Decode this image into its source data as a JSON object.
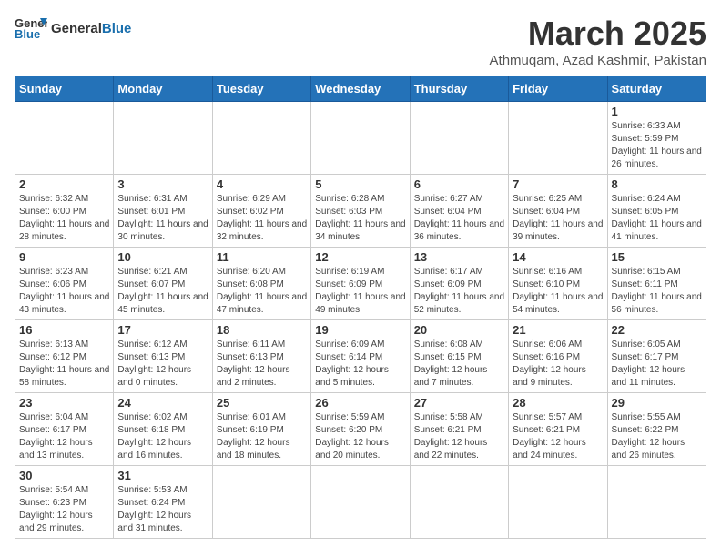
{
  "header": {
    "logo_general": "General",
    "logo_blue": "Blue",
    "month": "March 2025",
    "location": "Athmuqam, Azad Kashmir, Pakistan"
  },
  "weekdays": [
    "Sunday",
    "Monday",
    "Tuesday",
    "Wednesday",
    "Thursday",
    "Friday",
    "Saturday"
  ],
  "weeks": [
    [
      {
        "day": "",
        "info": ""
      },
      {
        "day": "",
        "info": ""
      },
      {
        "day": "",
        "info": ""
      },
      {
        "day": "",
        "info": ""
      },
      {
        "day": "",
        "info": ""
      },
      {
        "day": "",
        "info": ""
      },
      {
        "day": "1",
        "info": "Sunrise: 6:33 AM\nSunset: 5:59 PM\nDaylight: 11 hours and 26 minutes."
      }
    ],
    [
      {
        "day": "2",
        "info": "Sunrise: 6:32 AM\nSunset: 6:00 PM\nDaylight: 11 hours and 28 minutes."
      },
      {
        "day": "3",
        "info": "Sunrise: 6:31 AM\nSunset: 6:01 PM\nDaylight: 11 hours and 30 minutes."
      },
      {
        "day": "4",
        "info": "Sunrise: 6:29 AM\nSunset: 6:02 PM\nDaylight: 11 hours and 32 minutes."
      },
      {
        "day": "5",
        "info": "Sunrise: 6:28 AM\nSunset: 6:03 PM\nDaylight: 11 hours and 34 minutes."
      },
      {
        "day": "6",
        "info": "Sunrise: 6:27 AM\nSunset: 6:04 PM\nDaylight: 11 hours and 36 minutes."
      },
      {
        "day": "7",
        "info": "Sunrise: 6:25 AM\nSunset: 6:04 PM\nDaylight: 11 hours and 39 minutes."
      },
      {
        "day": "8",
        "info": "Sunrise: 6:24 AM\nSunset: 6:05 PM\nDaylight: 11 hours and 41 minutes."
      }
    ],
    [
      {
        "day": "9",
        "info": "Sunrise: 6:23 AM\nSunset: 6:06 PM\nDaylight: 11 hours and 43 minutes."
      },
      {
        "day": "10",
        "info": "Sunrise: 6:21 AM\nSunset: 6:07 PM\nDaylight: 11 hours and 45 minutes."
      },
      {
        "day": "11",
        "info": "Sunrise: 6:20 AM\nSunset: 6:08 PM\nDaylight: 11 hours and 47 minutes."
      },
      {
        "day": "12",
        "info": "Sunrise: 6:19 AM\nSunset: 6:09 PM\nDaylight: 11 hours and 49 minutes."
      },
      {
        "day": "13",
        "info": "Sunrise: 6:17 AM\nSunset: 6:09 PM\nDaylight: 11 hours and 52 minutes."
      },
      {
        "day": "14",
        "info": "Sunrise: 6:16 AM\nSunset: 6:10 PM\nDaylight: 11 hours and 54 minutes."
      },
      {
        "day": "15",
        "info": "Sunrise: 6:15 AM\nSunset: 6:11 PM\nDaylight: 11 hours and 56 minutes."
      }
    ],
    [
      {
        "day": "16",
        "info": "Sunrise: 6:13 AM\nSunset: 6:12 PM\nDaylight: 11 hours and 58 minutes."
      },
      {
        "day": "17",
        "info": "Sunrise: 6:12 AM\nSunset: 6:13 PM\nDaylight: 12 hours and 0 minutes."
      },
      {
        "day": "18",
        "info": "Sunrise: 6:11 AM\nSunset: 6:13 PM\nDaylight: 12 hours and 2 minutes."
      },
      {
        "day": "19",
        "info": "Sunrise: 6:09 AM\nSunset: 6:14 PM\nDaylight: 12 hours and 5 minutes."
      },
      {
        "day": "20",
        "info": "Sunrise: 6:08 AM\nSunset: 6:15 PM\nDaylight: 12 hours and 7 minutes."
      },
      {
        "day": "21",
        "info": "Sunrise: 6:06 AM\nSunset: 6:16 PM\nDaylight: 12 hours and 9 minutes."
      },
      {
        "day": "22",
        "info": "Sunrise: 6:05 AM\nSunset: 6:17 PM\nDaylight: 12 hours and 11 minutes."
      }
    ],
    [
      {
        "day": "23",
        "info": "Sunrise: 6:04 AM\nSunset: 6:17 PM\nDaylight: 12 hours and 13 minutes."
      },
      {
        "day": "24",
        "info": "Sunrise: 6:02 AM\nSunset: 6:18 PM\nDaylight: 12 hours and 16 minutes."
      },
      {
        "day": "25",
        "info": "Sunrise: 6:01 AM\nSunset: 6:19 PM\nDaylight: 12 hours and 18 minutes."
      },
      {
        "day": "26",
        "info": "Sunrise: 5:59 AM\nSunset: 6:20 PM\nDaylight: 12 hours and 20 minutes."
      },
      {
        "day": "27",
        "info": "Sunrise: 5:58 AM\nSunset: 6:21 PM\nDaylight: 12 hours and 22 minutes."
      },
      {
        "day": "28",
        "info": "Sunrise: 5:57 AM\nSunset: 6:21 PM\nDaylight: 12 hours and 24 minutes."
      },
      {
        "day": "29",
        "info": "Sunrise: 5:55 AM\nSunset: 6:22 PM\nDaylight: 12 hours and 26 minutes."
      }
    ],
    [
      {
        "day": "30",
        "info": "Sunrise: 5:54 AM\nSunset: 6:23 PM\nDaylight: 12 hours and 29 minutes."
      },
      {
        "day": "31",
        "info": "Sunrise: 5:53 AM\nSunset: 6:24 PM\nDaylight: 12 hours and 31 minutes."
      },
      {
        "day": "",
        "info": ""
      },
      {
        "day": "",
        "info": ""
      },
      {
        "day": "",
        "info": ""
      },
      {
        "day": "",
        "info": ""
      },
      {
        "day": "",
        "info": ""
      }
    ]
  ]
}
